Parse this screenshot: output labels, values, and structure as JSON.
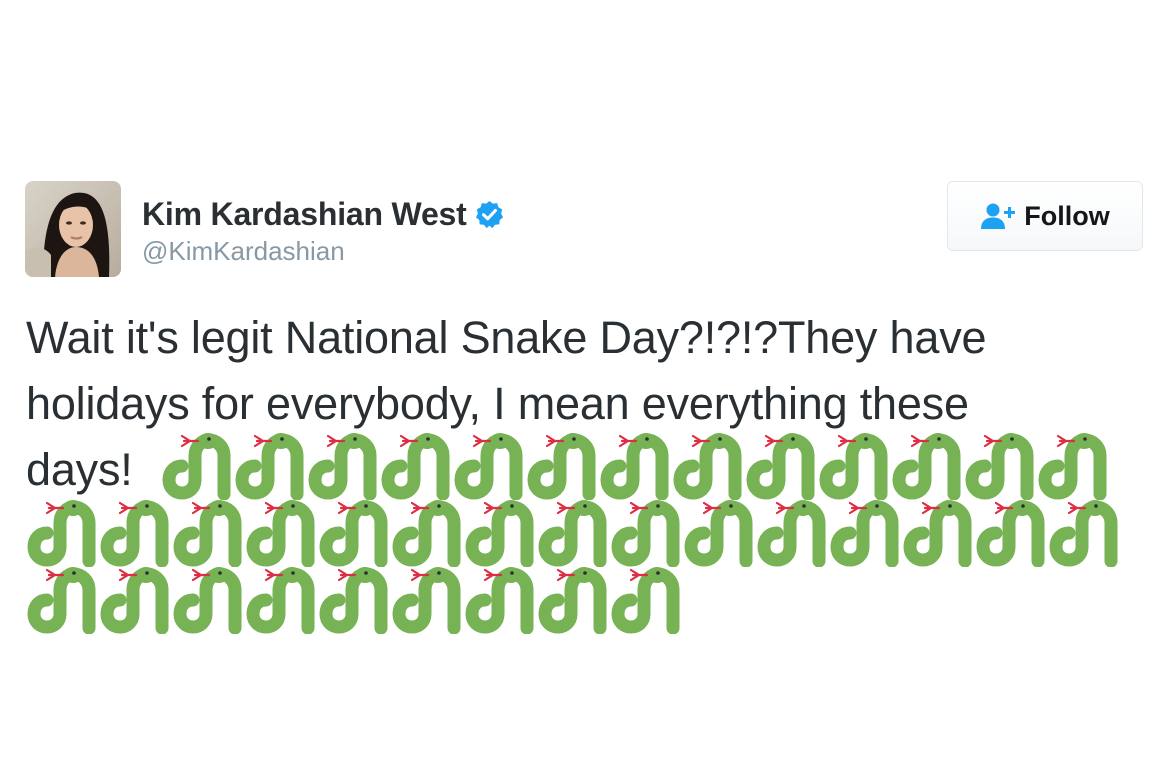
{
  "author": {
    "name": "Kim Kardashian West",
    "handle": "@KimKardashian",
    "verified": true
  },
  "follow_button": {
    "label": "Follow",
    "icon": "add-user-icon"
  },
  "tweet": {
    "lines": [
      "Wait it's legit National Snake Day?!?!?They have",
      "holidays for everybody, I mean everything these",
      "days!"
    ],
    "emoji": "snake",
    "emoji_rows": [
      13,
      15,
      9
    ],
    "emoji_total": 37
  },
  "colors": {
    "name": "#292f33",
    "handle": "#8899a6",
    "verified": "#1da1f2",
    "follow_icon": "#1da1f2",
    "snake_body": "#77b255",
    "snake_tongue": "#dd2e44"
  }
}
